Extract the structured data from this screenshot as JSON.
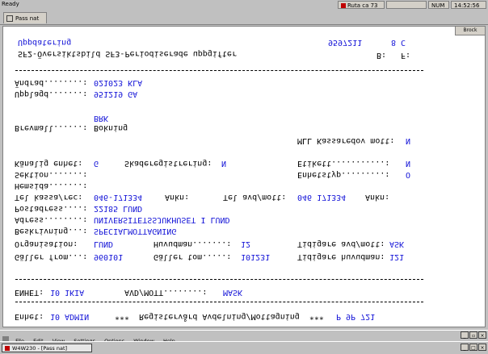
{
  "window": {
    "top_left_label": "Ready"
  },
  "topbar_segments": [
    {
      "text": "Ruta ca 73"
    },
    {
      "text": ""
    },
    {
      "text": "NUM"
    },
    {
      "text": "14:52:56"
    }
  ],
  "tab": {
    "label": "Pass nat"
  },
  "screen": {
    "brock_label": "Brock",
    "header": {
      "title": "Uppdatering",
      "subtitle": "SF2-Översiktsbild SF3-Periodiserade uppgifter",
      "code": "9597211",
      "code_suffix": "8 C",
      "flag_b_label": "B:",
      "flag_f_label": "F:"
    },
    "audit": {
      "andrad_label": "Ändrad........:",
      "andrad_value": "021023 KLA",
      "upplagd_label": "Upplagd.......:",
      "upplagd_value": "951219 GA"
    },
    "brev": {
      "bok_code": "BRK",
      "brevmall_label": "Brevmall......:",
      "brevmall_value": "Bokning"
    },
    "mll_label": "MLL Kassaredov mott:",
    "mll_value": "N",
    "fields": {
      "kanalig_label": "Känalig enhet:",
      "kanalig_value": "G",
      "skade_label": "Skaderegistrering:",
      "skade_value": "N",
      "etikett_label": "Etikett...........:",
      "etikett_value": "N",
      "sektion_label": "Sektion.......:",
      "enhetstyp_label": "Enhetstyp.........:",
      "enhetstyp_value": "O",
      "hemsida_label": "Hemsida.......:",
      "tel_kassa_label": "Tel kassa/rec:",
      "tel_kassa_value": "046-171334",
      "ankn1_label": "Ankn:",
      "tel_avd_label": "Tel avd/mott:",
      "tel_avd_value": "046 171334",
      "ankn2_label": "Ankn:",
      "postadress_label": "Postadress....:",
      "postadress_value": "22185 LUND",
      "adress_label": "Adress........:",
      "adress_value": "UNIVERSITETSSJUKHUSET I LUND",
      "beskrivning_label": "Beskrivning...:",
      "beskrivning_value": "SPECIALMOTTAGNING",
      "organisation_label": "Organisation:",
      "organisation_value": "LUND",
      "huvudman_label": "Huvudman.......:",
      "huvudman_value": "12",
      "tidigare_avd_label": "Tidigare avd/mott:",
      "tidigare_avd_value": "ASK",
      "galler_from_label": "Gäller from...:",
      "galler_from_value": "960101",
      "galler_tom_label": "Gäller tom.....:",
      "galler_tom_value": "101231",
      "tidigare_huvudman_label": "Tidigare huvudman:",
      "tidigare_huvudman_value": "121"
    },
    "enhet_row": {
      "enhet_label": "ENHET:",
      "enhet_value": "10 1KIA",
      "avd_label": "AVD/MOTT........:",
      "avd_value": "MASK"
    },
    "footer": {
      "enhet_label": "Enhet:",
      "enhet_value": "10 ADMIN",
      "message": "***  Registervård Avdelning/Mottagning  ***",
      "code": "P 9P 721"
    }
  },
  "menubar": {
    "items": [
      "File",
      "Edit",
      "View",
      "Settings",
      "Options",
      "Window",
      "Help"
    ]
  },
  "taskbar": {
    "task_label": "W4W230 - [Pass nat]"
  },
  "colors": {
    "terminal_bg": "#ffffff",
    "label_color": "#000000",
    "value_color": "#1515d8",
    "chrome": "#c0c0c0"
  }
}
